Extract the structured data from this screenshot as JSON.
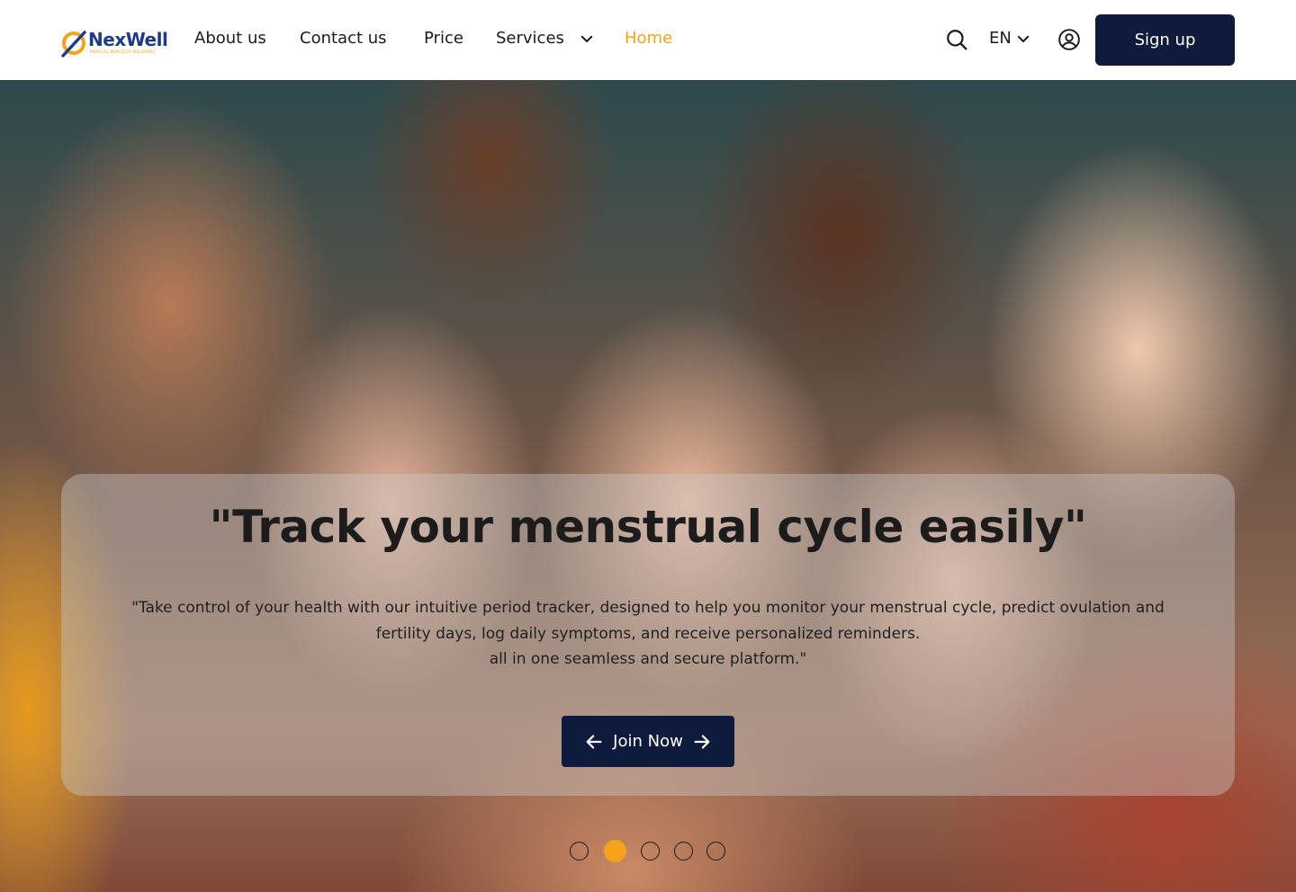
{
  "brand": {
    "name": "NexWell",
    "tagline": "PARALLEL WORLD OF WELLBEING"
  },
  "nav": {
    "items": [
      {
        "label": "About us"
      },
      {
        "label": "Contact us"
      },
      {
        "label": "Price"
      },
      {
        "label": "Services"
      },
      {
        "label": "Home"
      }
    ],
    "active": "Home"
  },
  "header": {
    "language": "EN",
    "signup_label": "Sign up"
  },
  "hero": {
    "title": "\"Track your menstrual cycle easily\"",
    "description_lines": [
      "\"Take control of your health with our intuitive period tracker, designed to help you monitor your menstrual cycle, predict ovulation and",
      "fertility days, log daily symptoms, and receive personalized reminders.",
      "all in one seamless and secure platform.\""
    ],
    "cta_label": "Join Now"
  },
  "carousel": {
    "slide_count": 5,
    "active_index": 2
  },
  "colors": {
    "accent": "#f0a515",
    "navy": "#0f1b3d",
    "brand_blue": "#1e3a8a"
  }
}
